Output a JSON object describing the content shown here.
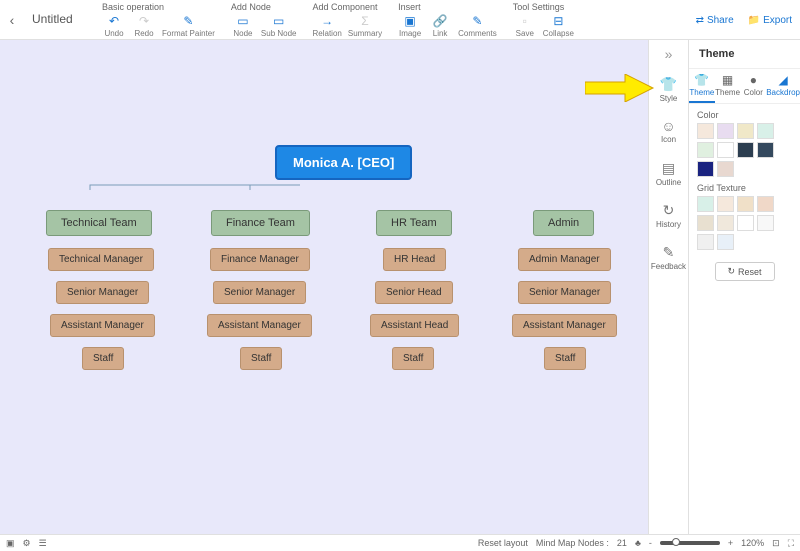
{
  "header": {
    "title": "Untitled",
    "share": "Share",
    "export": "Export",
    "groups": [
      {
        "label": "Basic operation",
        "items": [
          {
            "id": "undo",
            "label": "Undo",
            "icon": "↶"
          },
          {
            "id": "redo",
            "label": "Redo",
            "icon": "↷",
            "disabled": true
          },
          {
            "id": "format-painter",
            "label": "Format Painter",
            "icon": "✎"
          }
        ]
      },
      {
        "label": "Add Node",
        "items": [
          {
            "id": "node",
            "label": "Node",
            "icon": "▭"
          },
          {
            "id": "sub-node",
            "label": "Sub Node",
            "icon": "▭"
          }
        ]
      },
      {
        "label": "Add Component",
        "items": [
          {
            "id": "relation",
            "label": "Relation",
            "icon": "→"
          },
          {
            "id": "summary",
            "label": "Summary",
            "icon": "Σ",
            "disabled": true
          }
        ]
      },
      {
        "label": "Insert",
        "items": [
          {
            "id": "image",
            "label": "Image",
            "icon": "▣"
          },
          {
            "id": "link",
            "label": "Link",
            "icon": "🔗"
          },
          {
            "id": "comments",
            "label": "Comments",
            "icon": "✎"
          }
        ]
      },
      {
        "label": "Tool Settings",
        "items": [
          {
            "id": "save",
            "label": "Save",
            "icon": "▫",
            "disabled": true
          },
          {
            "id": "collapse",
            "label": "Collapse",
            "icon": "⊟"
          }
        ]
      }
    ]
  },
  "mindmap": {
    "root": "Monica A. [CEO]",
    "branches": [
      {
        "name": "Technical Team",
        "nodes": [
          "Technical Manager",
          "Senior Manager",
          "Assistant Manager",
          "Staff"
        ]
      },
      {
        "name": "Finance Team",
        "nodes": [
          "Finance Manager",
          "Senior Manager",
          "Assistant Manager",
          "Staff"
        ]
      },
      {
        "name": "HR Team",
        "nodes": [
          "HR Head",
          "Senior Head",
          "Assistant Head",
          "Staff"
        ]
      },
      {
        "name": "Admin",
        "nodes": [
          "Admin Manager",
          "Senior Manager",
          "Assistant Manager",
          "Staff"
        ]
      }
    ]
  },
  "sidestrip": [
    {
      "id": "style",
      "label": "Style",
      "icon": "👕"
    },
    {
      "id": "icon",
      "label": "Icon",
      "icon": "☺"
    },
    {
      "id": "outline",
      "label": "Outline",
      "icon": "▤"
    },
    {
      "id": "history",
      "label": "History",
      "icon": "↻"
    },
    {
      "id": "feedback",
      "label": "Feedback",
      "icon": "✎"
    }
  ],
  "panel": {
    "title": "Theme",
    "tabs": [
      {
        "id": "theme-tab",
        "label": "Theme",
        "active": true
      },
      {
        "id": "theme2-tab",
        "label": "Theme"
      },
      {
        "id": "color-tab",
        "label": "Color"
      },
      {
        "id": "backdrop-tab",
        "label": "Backdrop"
      }
    ],
    "color_label": "Color",
    "colors": [
      "#f5e8dc",
      "#e8dcf0",
      "#f0e8c8",
      "#d8f0e8",
      "#e0f0e0",
      "#ffffff",
      "#2c3e50",
      "#34495e",
      "#1a2380",
      "#e8d8d0"
    ],
    "grid_label": "Grid Texture",
    "grid_colors": [
      "#d8f0e8",
      "#f5e8dc",
      "#f0e0c8",
      "#f0d8c8",
      "#e8e0d0",
      "#f0e8dc",
      "#ffffff",
      "#f8f8f8",
      "#f0f0f0",
      "#e8f0f8"
    ],
    "reset": "Reset"
  },
  "status": {
    "reset_layout": "Reset layout",
    "nodes_label": "Mind Map Nodes :",
    "nodes_count": "21",
    "zoom_minus": "-",
    "zoom_plus": "+",
    "zoom_value": "120%"
  }
}
